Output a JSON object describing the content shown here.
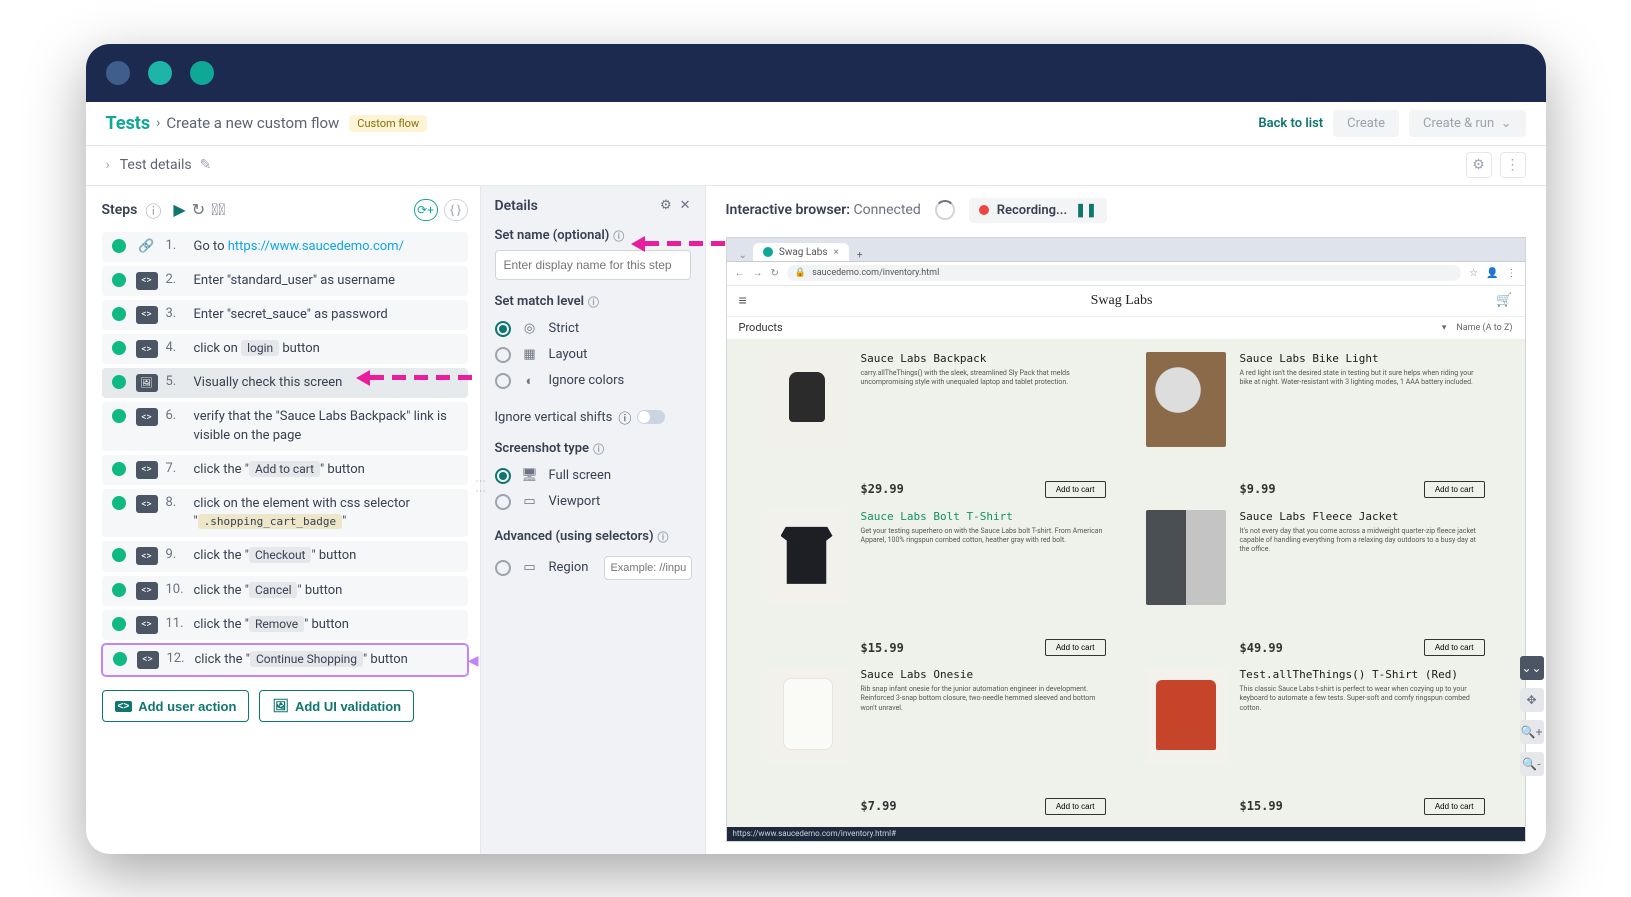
{
  "header": {
    "title": "Tests",
    "subtitle": "Create a new custom flow",
    "badge": "Custom flow",
    "back": "Back to list",
    "create": "Create",
    "create_run": "Create & run"
  },
  "subheader": {
    "title": "Test details"
  },
  "steps_panel": {
    "label": "Steps"
  },
  "steps": [
    {
      "num": "1.",
      "type": "link",
      "prefix": "Go to ",
      "url": "https://www.saucedemo.com/"
    },
    {
      "num": "2.",
      "type": "code",
      "text": "Enter \"standard_user\" as username"
    },
    {
      "num": "3.",
      "type": "code",
      "text": "Enter \"secret_sauce\" as password"
    },
    {
      "num": "4.",
      "type": "code",
      "text_before": "click on ",
      "badge": "login",
      "text_after": " button"
    },
    {
      "num": "5.",
      "type": "img",
      "text": "Visually check this screen",
      "selected": true
    },
    {
      "num": "6.",
      "type": "code",
      "text": "verify that the \"Sauce Labs Backpack\" link is visible on the page"
    },
    {
      "num": "7.",
      "type": "code",
      "text_before": "click the \"",
      "badge": "Add to cart",
      "text_after": "\" button"
    },
    {
      "num": "8.",
      "type": "code",
      "text_before": "click on the element with css selector \"",
      "code": ".shopping_cart_badge",
      "text_after": "\""
    },
    {
      "num": "9.",
      "type": "code",
      "text_before": "click the \"",
      "badge": "Checkout",
      "text_after": "\" button"
    },
    {
      "num": "10.",
      "type": "code",
      "text_before": "click the \"",
      "badge": "Cancel",
      "text_after": "\" button"
    },
    {
      "num": "11.",
      "type": "code",
      "text_before": "click the \"",
      "badge": "Remove",
      "text_after": "\" button"
    },
    {
      "num": "12.",
      "type": "code",
      "text_before": "click the \"",
      "badge": "Continue Shopping",
      "text_after": "\" button",
      "highlight": true
    }
  ],
  "actions": {
    "add_user": "Add user action",
    "add_ui": "Add UI validation"
  },
  "details": {
    "title": "Details",
    "set_name_label": "Set name (optional)",
    "set_name_placeholder": "Enter display name for this step",
    "match_level_label": "Set match level",
    "match_strict": "Strict",
    "match_layout": "Layout",
    "match_ignore": "Ignore colors",
    "ignore_shifts": "Ignore vertical shifts",
    "screenshot_label": "Screenshot type",
    "ss_full": "Full screen",
    "ss_viewport": "Viewport",
    "advanced_label": "Advanced (using selectors)",
    "region": "Region",
    "region_placeholder": "Example: //inpu"
  },
  "browser": {
    "status_label": "Interactive browser:",
    "status_value": "Connected",
    "recording": "Recording...",
    "tab_title": "Swag Labs",
    "url": "saucedemo.com/inventory.html",
    "status_bar": "https://www.saucedemo.com/inventory.html#"
  },
  "swag": {
    "title": "Swag Labs",
    "products_label": "Products",
    "sort": "Name (A to Z)",
    "add_to_cart": "Add to cart",
    "items": [
      {
        "name": "Sauce Labs Backpack",
        "desc": "carry.allTheThings() with the sleek, streamlined Sly Pack that melds uncompromising style with unequaled laptop and tablet protection.",
        "price": "$29.99",
        "thumb": "thumb-backpack",
        "green": false
      },
      {
        "name": "Sauce Labs Bike Light",
        "desc": "A red light isn't the desired state in testing but it sure helps when riding your bike at night. Water-resistant with 3 lighting modes, 1 AAA battery included.",
        "price": "$9.99",
        "thumb": "thumb-bikelight",
        "green": false
      },
      {
        "name": "Sauce Labs Bolt T-Shirt",
        "desc": "Get your testing superhero on with the Sauce Labs bolt T-shirt. From American Apparel, 100% ringspun combed cotton, heather gray with red bolt.",
        "price": "$15.99",
        "thumb": "thumb-tee",
        "green": true
      },
      {
        "name": "Sauce Labs Fleece Jacket",
        "desc": "It's not every day that you come across a midweight quarter-zip fleece jacket capable of handling everything from a relaxing day outdoors to a busy day at the office.",
        "price": "$49.99",
        "thumb": "thumb-fleece",
        "green": false
      },
      {
        "name": "Sauce Labs Onesie",
        "desc": "Rib snap infant onesie for the junior automation engineer in development. Reinforced 3-snap bottom closure, two-needle hemmed sleeved and bottom won't unravel.",
        "price": "$7.99",
        "thumb": "thumb-onesie",
        "green": false
      },
      {
        "name": "Test.allTheThings() T-Shirt (Red)",
        "desc": "This classic Sauce Labs t-shirt is perfect to wear when cozying up to your keyboard to automate a few tests. Super-soft and comfy ringspun combed cotton.",
        "price": "$15.99",
        "thumb": "thumb-red",
        "green": false
      }
    ]
  }
}
